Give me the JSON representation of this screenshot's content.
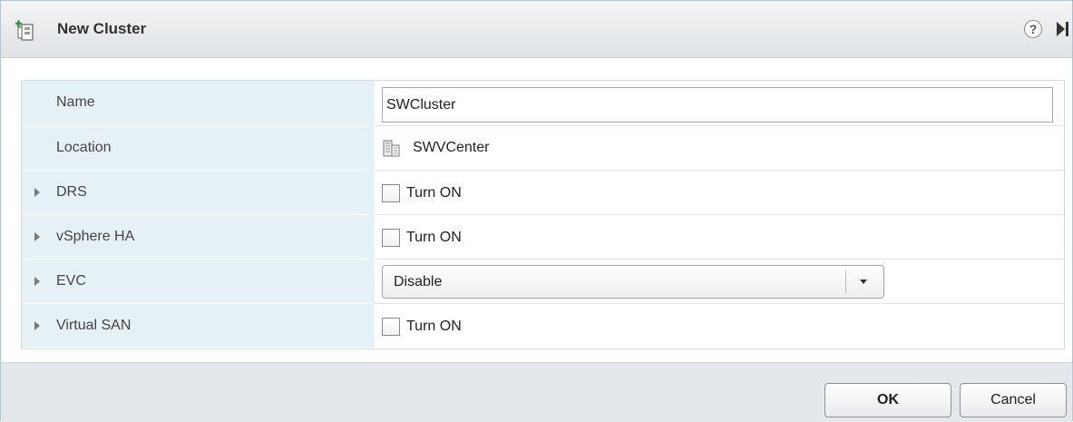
{
  "dialog": {
    "title": "New Cluster",
    "help_symbol": "?"
  },
  "form": {
    "name": {
      "label": "Name",
      "value": "SWCluster"
    },
    "location": {
      "label": "Location",
      "value": "SWVCenter",
      "icon": "datacenter-icon"
    },
    "drs": {
      "label": "DRS",
      "checkbox_label": "Turn ON",
      "checked": false
    },
    "vsphere_ha": {
      "label": "vSphere HA",
      "checkbox_label": "Turn ON",
      "checked": false
    },
    "evc": {
      "label": "EVC",
      "selected": "Disable"
    },
    "virtual_san": {
      "label": "Virtual SAN",
      "checkbox_label": "Turn ON",
      "checked": false
    }
  },
  "footer": {
    "ok_label": "OK",
    "cancel_label": "Cancel"
  },
  "colors": {
    "label_bg": "#e6f0f7",
    "titlebar_bg": "#dfe2e5",
    "footer_bg": "#e4e8ec"
  }
}
